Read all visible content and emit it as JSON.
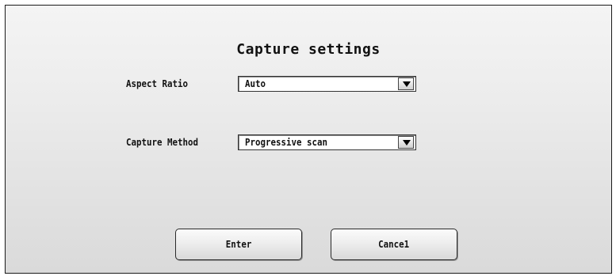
{
  "dialog": {
    "title": "Capture settings"
  },
  "fields": {
    "aspect_ratio": {
      "label": "Aspect Ratio",
      "value": "Auto"
    },
    "capture_method": {
      "label": "Capture Method",
      "value": "Progressive scan"
    }
  },
  "buttons": {
    "enter_label": "Enter",
    "cancel_label": "Cance1"
  },
  "icons": {
    "dropdown": "chevron-down-icon"
  }
}
